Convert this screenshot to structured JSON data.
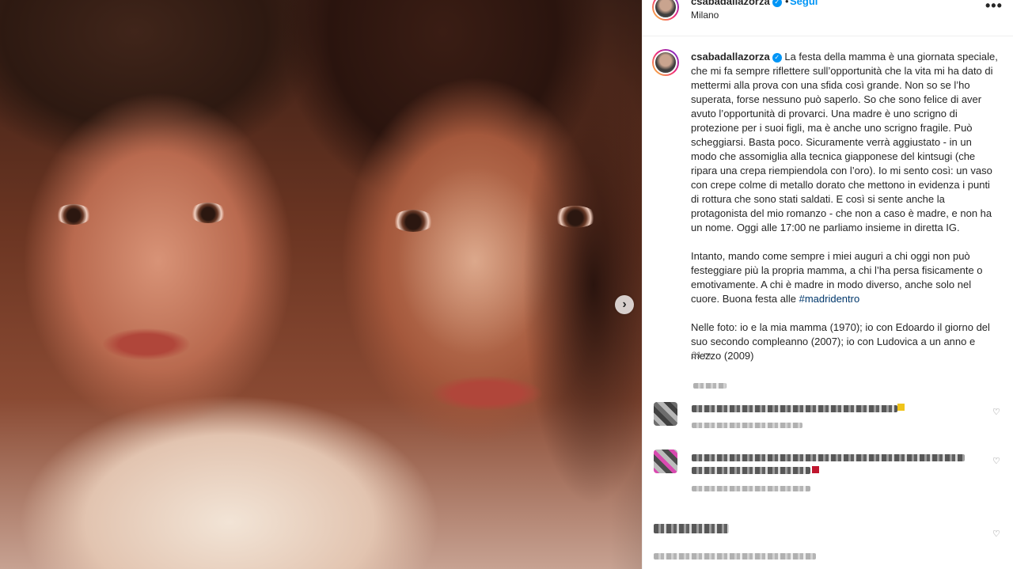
{
  "post": {
    "username": "csabadallazorza",
    "follow_label": "Segui",
    "dot": "•",
    "location": "Milano",
    "more_label": "•••",
    "next_label": "›",
    "verified_glyph": "✓"
  },
  "caption": {
    "username": "csabadallazorza",
    "paragraph1": "La festa della mamma è una giornata speciale, che mi fa sempre riflettere sull’opportunità che la vita mi ha dato di mettermi alla prova con una sfida così grande. Non so se l’ho superata, forse nessuno può saperlo. So che sono felice di aver avuto l’opportunità di provarci. Una madre è uno scrigno di protezione per i suoi figli, ma è anche uno scrigno fragile. Può scheggiarsi. Basta poco. Sicuramente verrà aggiustato - in un modo che assomiglia alla tecnica giapponese del kintsugi (che ripara una crepa riempiendola con l’oro). Io mi sento così: un vaso con crepe colme di metallo dorato che mettono in evidenza i punti di rottura che sono stati saldati. E così si sente anche la protagonista del mio romanzo - che non a caso è madre, e non ha un nome. Oggi alle 17:00 ne parliamo insieme in diretta IG.",
    "paragraph2": "Intanto, mando come sempre i miei auguri a chi oggi non può festeggiare più la propria mamma, a chi l’ha persa fisicamente o emotivamente. A chi è madre in modo diverso, anche solo nel cuore. Buona festa alle",
    "hashtag": "#madridentro",
    "paragraph3": "Nelle foto: io e la mia mamma (1970); io con Edoardo il giorno del suo secondo compleanno (2007); io con Ludovica a un anno e mezzo (2009)",
    "time": "31 m"
  },
  "icons": {
    "heart": "♡"
  },
  "colors": {
    "link": "#0095f6",
    "hashtag": "#00376b",
    "muted": "#737373"
  }
}
